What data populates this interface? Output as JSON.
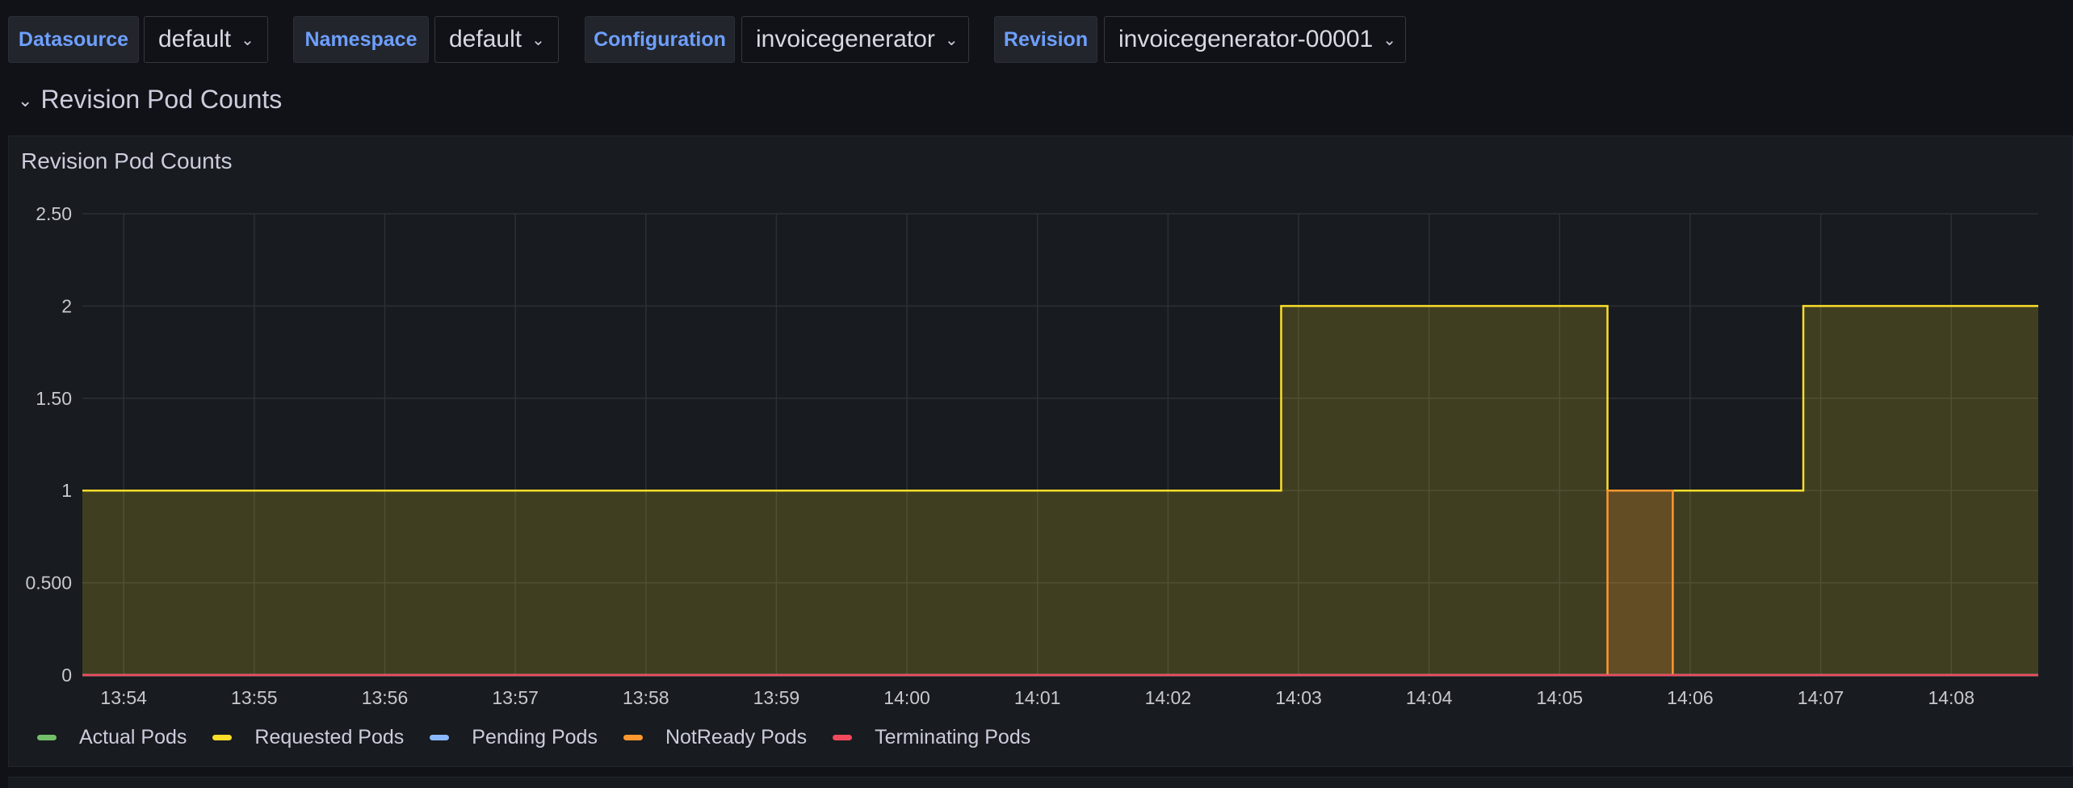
{
  "variables": [
    {
      "label": "Datasource",
      "value": "default"
    },
    {
      "label": "Namespace",
      "value": "default"
    },
    {
      "label": "Configuration",
      "value": "invoicegenerator"
    },
    {
      "label": "Revision",
      "value": "invoicegenerator-00001"
    }
  ],
  "row": {
    "title": "Revision Pod Counts"
  },
  "panel": {
    "title": "Revision Pod Counts"
  },
  "chart_data": {
    "type": "line",
    "title": "Revision Pod Counts",
    "x_ticks": [
      "13:54",
      "13:55",
      "13:56",
      "13:57",
      "13:58",
      "13:59",
      "14:00",
      "14:01",
      "14:02",
      "14:03",
      "14:04",
      "14:05",
      "14:06",
      "14:07",
      "14:08"
    ],
    "y_ticks": [
      "0",
      "0.500",
      "1",
      "1.50",
      "2",
      "2.50"
    ],
    "xlim": [
      "13:53:41",
      "14:08:40"
    ],
    "ylim": [
      0,
      2.5
    ],
    "grid": true,
    "legend_position": "bottom-left",
    "series": [
      {
        "name": "Actual Pods",
        "color": "#73bf69",
        "steps": [
          [
            "13:53:41",
            0
          ],
          [
            "14:08:40",
            0
          ]
        ]
      },
      {
        "name": "Requested Pods",
        "color": "#fade2a",
        "fill": true,
        "steps": [
          [
            "13:53:41",
            1
          ],
          [
            "14:02:52",
            2
          ],
          [
            "14:05:22",
            1
          ],
          [
            "14:06:52",
            2
          ],
          [
            "14:08:40",
            2
          ]
        ]
      },
      {
        "name": "Pending Pods",
        "color": "#8ab8ff",
        "steps": [
          [
            "13:53:41",
            0
          ],
          [
            "14:08:40",
            0
          ]
        ]
      },
      {
        "name": "NotReady Pods",
        "color": "#ff9830",
        "fill": true,
        "steps": [
          [
            "13:53:41",
            0
          ],
          [
            "14:05:22",
            1
          ],
          [
            "14:05:52",
            0
          ],
          [
            "14:08:40",
            0
          ]
        ]
      },
      {
        "name": "Terminating Pods",
        "color": "#f2495c",
        "steps": [
          [
            "13:53:41",
            0
          ],
          [
            "14:08:40",
            0
          ]
        ]
      }
    ]
  }
}
